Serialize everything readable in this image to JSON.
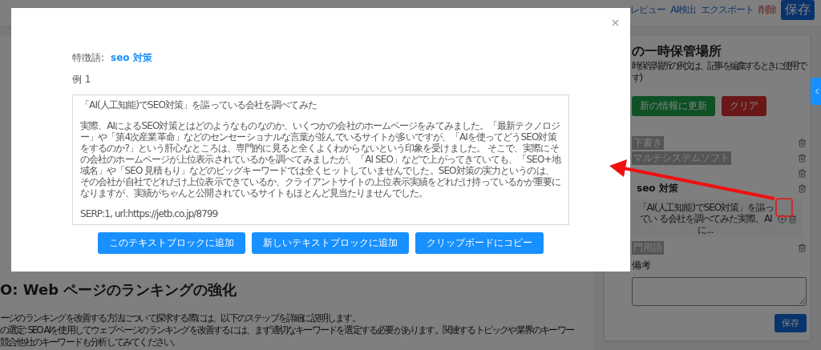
{
  "toolbar": {
    "links": [
      {
        "label": "レビュー",
        "kind": "link"
      },
      {
        "label": "AI検出",
        "kind": "link"
      },
      {
        "label": "エクスポート",
        "kind": "link"
      },
      {
        "label": "削除",
        "kind": "danger"
      }
    ],
    "save": "保存"
  },
  "article": {
    "heading": "O: Web ページのランキングの強化",
    "lines": [
      "ージのランキングを改善する方法について探求する際には、以下のステップを詳細に説明します。",
      "の選定: SEO AIを使用してウェブページのランキングを改善するには、まず適切なキーワードを選定する必要があります。関連するトピックや業界のキーワー",
      "競合他社のキーワードも分析してみてください。"
    ]
  },
  "side_panel": {
    "title": "の一時保管場所",
    "note_lines": [
      "時保管場所の例文は、記事を編集するときに使用で",
      "す)"
    ],
    "refresh": "新の情報に更新",
    "clear": "クリア",
    "items": [
      {
        "label": "下書き",
        "kind": "folder"
      },
      {
        "label": "マルチシステムソフト",
        "kind": "folder"
      },
      {
        "kind": "hidden"
      },
      {
        "label": "seo 対策",
        "kind": "keyword",
        "children": [
          {
            "label": "「AI(人工知能)でSEO対策」を謳ってい る会社を調べてみた実際、AIに...",
            "kind": "snippet"
          }
        ]
      },
      {
        "label": "門用語",
        "kind": "folder"
      }
    ],
    "notes_label": "備考",
    "save": "保存"
  },
  "modal": {
    "keyword_label": "特徴語:",
    "keyword": "seo 対策",
    "example_label": "例 1",
    "example": {
      "title": "「AI(人工知能)でSEO対策」を謳っている会社を調べてみた",
      "body": "実際、AIによるSEO対策とはどのようなものなのか、いくつかの会社のホームページをみてみました。「最新テクノロジー」や「第4次産業革命」などのセンセーショナルな言葉が並んでいるサイトが多いですが、「AIを使ってどうSEO対策をするのか?」という肝心なところは、専門的に見ると全くよくわからないという印象を受けました。 そこで、実際にその会社のホームページが上位表示されているかを調べてみましたが、「AI SEO」などで上がってきていても、「SEO+地域名」や「SEO 見積もり」などのビッグキーワードでは全くヒットしていませんでした。SEO対策の実力というのは、その会社が自社でどれだけ上位表示できているか、クライアントサイトの上位表示実績をどれだけ持っているかが重要になりますが、実績がちゃんと公開されているサイトもほとんど見当たりませんでした。",
      "source": "SERP:1, url:https://jetb.co.jp/8799"
    },
    "buttons": [
      "このテキストブロックに追加",
      "新しいテキストブロックに追加",
      "クリップボードにコピー"
    ]
  }
}
